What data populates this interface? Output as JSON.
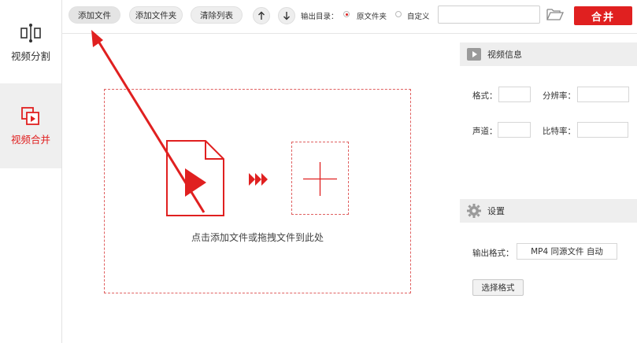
{
  "sidebar": {
    "items": [
      {
        "label": "视频分割",
        "icon": "split-icon"
      },
      {
        "label": "视频合并",
        "icon": "merge-icon"
      }
    ]
  },
  "toolbar": {
    "add_file": "添加文件",
    "add_folder": "添加文件夹",
    "clear_list": "清除列表",
    "move_up_icon": "arrow-up-icon",
    "move_down_icon": "arrow-down-icon",
    "output_dir_label": "输出目录：",
    "radio_original": "原文件夹",
    "radio_custom": "自定义",
    "output_path_value": "",
    "merge_button": "合并"
  },
  "dropzone": {
    "hint": "点击添加文件或拖拽文件到此处"
  },
  "video_info": {
    "title": "视频信息",
    "format_label": "格式：",
    "resolution_label": "分辨率：",
    "channel_label": "声道：",
    "bitrate_label": "比特率：",
    "format_value": "",
    "resolution_value": "",
    "channel_value": "",
    "bitrate_value": ""
  },
  "settings": {
    "title": "设置",
    "output_format_label": "输出格式：",
    "output_format_value": "MP4 同源文件 自动",
    "choose_format_button": "选择格式"
  },
  "colors": {
    "accent": "#e02020",
    "panel_bg": "#eeeeee",
    "sidebar_active_bg": "#efefef"
  }
}
